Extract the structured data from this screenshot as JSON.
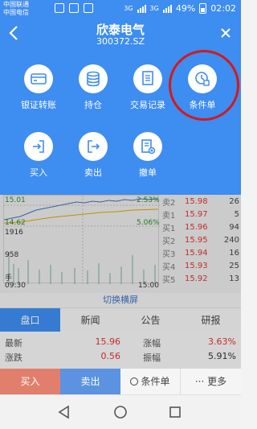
{
  "status": {
    "carrier1": "中国联通",
    "carrier2": "中国电信",
    "net1": "3G",
    "net2": "3G",
    "battery": "49%",
    "time": "02:02"
  },
  "header": {
    "title": "欣泰电气",
    "code": "300372.SZ"
  },
  "menu": {
    "items": [
      {
        "label": "银证转账",
        "icon": "card-icon"
      },
      {
        "label": "持仓",
        "icon": "coins-icon"
      },
      {
        "label": "交易记录",
        "icon": "document-icon"
      },
      {
        "label": "条件单",
        "icon": "clock-doc-icon"
      },
      {
        "label": "买入",
        "icon": "login-icon"
      },
      {
        "label": "卖出",
        "icon": "logout-icon"
      },
      {
        "label": "撤单",
        "icon": "cancel-doc-icon"
      }
    ]
  },
  "chart": {
    "price_top": "15.01",
    "pct_top": "2.53%",
    "price_mid": "14.62",
    "pct_mid": "5.06%",
    "vol_top": "1916",
    "vol_mid": "958",
    "vol_unit": "手",
    "time_start": "09:30",
    "time_end": "15:00"
  },
  "orderbook": [
    {
      "label": "卖2",
      "price": "15.98",
      "qty": "26"
    },
    {
      "label": "卖1",
      "price": "15.97",
      "qty": "5"
    },
    {
      "label": "买1",
      "price": "15.96",
      "qty": "94"
    },
    {
      "label": "买2",
      "price": "15.95",
      "qty": "240"
    },
    {
      "label": "买3",
      "price": "15.94",
      "qty": "16"
    },
    {
      "label": "买4",
      "price": "15.93",
      "qty": "25"
    },
    {
      "label": "买5",
      "price": "15.92",
      "qty": "13"
    }
  ],
  "switch_label": "切换横屏",
  "tabs": [
    "盘口",
    "新闻",
    "公告",
    "研报"
  ],
  "stats": {
    "latest_label": "最新",
    "latest_val": "15.96",
    "change_label": "涨幅",
    "change_val": "3.63%",
    "diff_label": "涨跌",
    "diff_val": "0.56",
    "amp_label": "振幅",
    "amp_val": "5.91%"
  },
  "bottombar": {
    "buy": "买入",
    "sell": "卖出",
    "cond": "条件单",
    "more": "··· 更多"
  },
  "colors": {
    "primary": "#3e8df0",
    "highlight": "#d31a1a",
    "up": "#d33333"
  }
}
